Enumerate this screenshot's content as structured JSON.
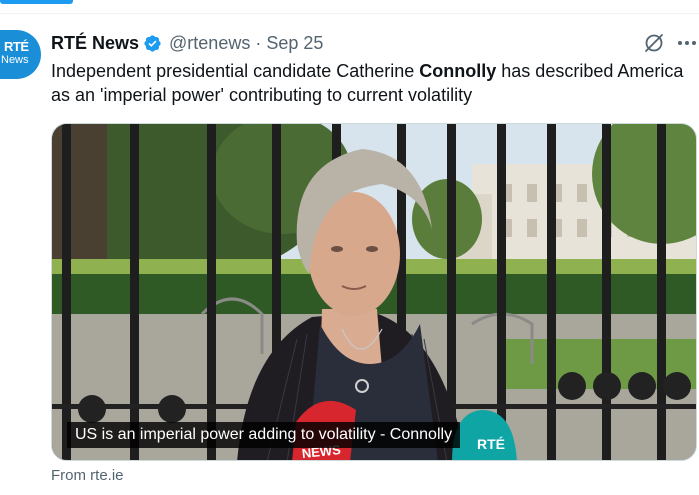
{
  "tweet": {
    "author": {
      "display_name": "RTÉ News",
      "handle": "@rtenews",
      "date": "Sep 25",
      "verified": true,
      "avatar_lines": [
        "RTÉ",
        "News"
      ]
    },
    "text": {
      "part1": "Independent presidential candidate Catherine ",
      "bold": "Connolly",
      "part2": " has described America as an 'imperial power' contributing to current volatility"
    },
    "media": {
      "caption": "US is an imperial power adding to volatility - Connolly",
      "mic_labels": [
        "NEWS",
        "RTÉ"
      ]
    },
    "card_source": "From rte.ie",
    "icons": {
      "grok": "grok-icon",
      "more": "more-icon",
      "verified": "verified-badge-icon"
    }
  },
  "colors": {
    "accent": "#1d9bf0",
    "text_primary": "#0f1419",
    "text_secondary": "#536471",
    "avatar_bg": "#1a8fd8"
  }
}
